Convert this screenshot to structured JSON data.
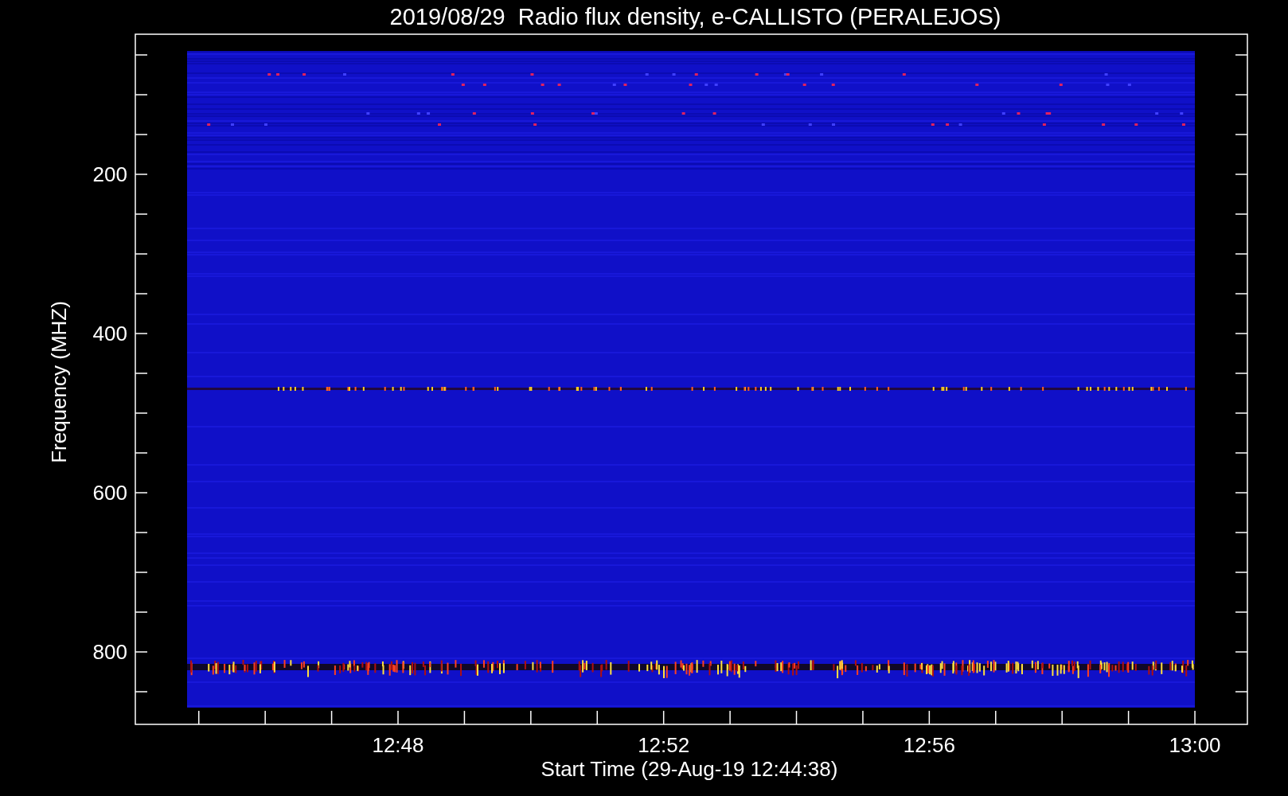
{
  "title": "2019/08/29  Radio flux density, e-CALLISTO (PERALEJOS)",
  "y_axis": {
    "label": "Frequency (MHZ)",
    "ticks": [
      "200",
      "400",
      "600",
      "800"
    ]
  },
  "x_axis": {
    "label": "Start Time (29-Aug-19 12:44:38)",
    "ticks": [
      "12:48",
      "12:52",
      "12:56",
      "13:00"
    ]
  }
}
